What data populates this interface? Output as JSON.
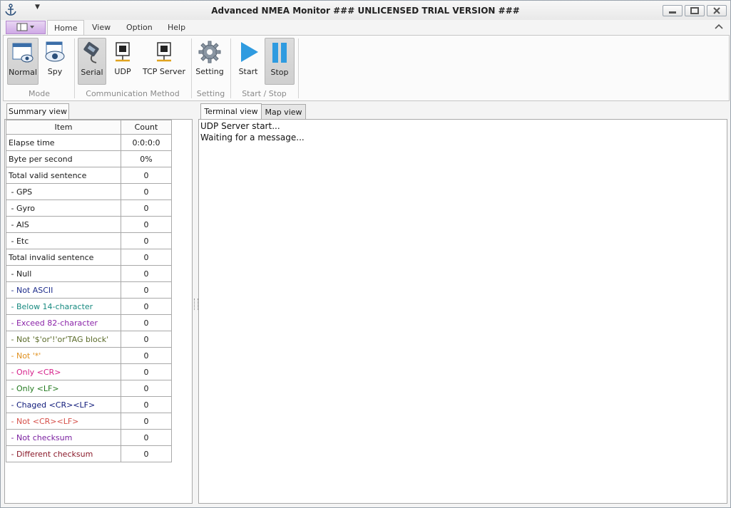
{
  "window": {
    "title": "Advanced NMEA Monitor   ### UNLICENSED TRIAL VERSION ###"
  },
  "ribbon": {
    "tabs": [
      "Home",
      "View",
      "Option",
      "Help"
    ],
    "active_tab": "Home",
    "groups": [
      {
        "label": "Mode",
        "buttons": [
          {
            "label": "Normal",
            "icon": "window-eye-icon",
            "pressed": true
          },
          {
            "label": "Spy",
            "icon": "spy-eye-icon",
            "pressed": false
          }
        ]
      },
      {
        "label": "Communication Method",
        "buttons": [
          {
            "label": "Serial",
            "icon": "serial-cable-icon",
            "pressed": true
          },
          {
            "label": "UDP",
            "icon": "network-port-icon",
            "pressed": false
          },
          {
            "label": "TCP Server",
            "icon": "network-port-icon",
            "pressed": false
          }
        ]
      },
      {
        "label": "Setting",
        "buttons": [
          {
            "label": "Setting",
            "icon": "gear-icon",
            "pressed": false
          }
        ]
      },
      {
        "label": "Start / Stop",
        "buttons": [
          {
            "label": "Start",
            "icon": "play-icon",
            "pressed": false
          },
          {
            "label": "Stop",
            "icon": "pause-icon",
            "pressed": true
          }
        ]
      }
    ]
  },
  "summary": {
    "tab_label": "Summary view",
    "headers": {
      "item": "Item",
      "count": "Count"
    },
    "rows": [
      {
        "item": "Elapse time",
        "count": "0:0:0:0",
        "color": "#1a1a1a"
      },
      {
        "item": "Byte per second",
        "count": "0%",
        "color": "#1a1a1a"
      },
      {
        "item": "Total valid sentence",
        "count": "0",
        "color": "#1a1a1a"
      },
      {
        "item": " - GPS",
        "count": "0",
        "color": "#1a1a1a"
      },
      {
        "item": " - Gyro",
        "count": "0",
        "color": "#1a1a1a"
      },
      {
        "item": " - AIS",
        "count": "0",
        "color": "#1a1a1a"
      },
      {
        "item": " - Etc",
        "count": "0",
        "color": "#1a1a1a"
      },
      {
        "item": "Total invalid sentence",
        "count": "0",
        "color": "#1a1a1a"
      },
      {
        "item": " - Null",
        "count": "0",
        "color": "#1a1a1a"
      },
      {
        "item": " - Not ASCII",
        "count": "0",
        "color": "#1f2e8c"
      },
      {
        "item": " - Below 14-character",
        "count": "0",
        "color": "#178a80"
      },
      {
        "item": " - Exceed 82-character",
        "count": "0",
        "color": "#8a23a8"
      },
      {
        "item": " - Not '$'or'!'or'TAG block'",
        "count": "0",
        "color": "#5b6b2a"
      },
      {
        "item": " - Not '*'",
        "count": "0",
        "color": "#e0901e"
      },
      {
        "item": " - Only <CR>",
        "count": "0",
        "color": "#d61f8a"
      },
      {
        "item": " - Only <LF>",
        "count": "0",
        "color": "#237a1f"
      },
      {
        "item": " - Chaged <CR><LF>",
        "count": "0",
        "color": "#0f1a7a"
      },
      {
        "item": " - Not <CR><LF>",
        "count": "0",
        "color": "#d6504a"
      },
      {
        "item": " - Not checksum",
        "count": "0",
        "color": "#7a1fa0"
      },
      {
        "item": " - Different checksum",
        "count": "0",
        "color": "#8a1a2a"
      }
    ]
  },
  "right_tabs": [
    {
      "label": "Terminal view",
      "active": true
    },
    {
      "label": "Map view",
      "active": false
    }
  ],
  "terminal": {
    "lines": [
      "UDP Server start...",
      "Waiting for a message..."
    ]
  }
}
